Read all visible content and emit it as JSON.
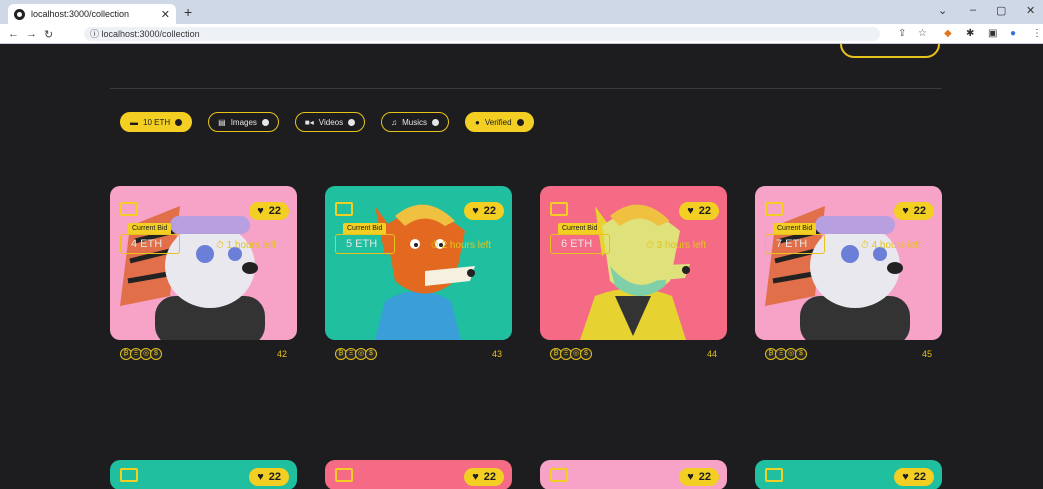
{
  "browser": {
    "tab_title": "localhost:3000/collection",
    "url": "localhost:3000/collection"
  },
  "filters": [
    {
      "label": "10 ETH",
      "active": true,
      "icon": "wallet-icon"
    },
    {
      "label": "Images",
      "active": false,
      "icon": "image-icon"
    },
    {
      "label": "Videos",
      "active": false,
      "icon": "video-icon"
    },
    {
      "label": "Musics",
      "active": false,
      "icon": "music-icon"
    },
    {
      "label": "Verified",
      "active": true,
      "icon": "user-icon"
    }
  ],
  "cards": [
    {
      "likes": "22",
      "id": "42",
      "bid_label": "Current Bid",
      "bid": "4 ETH",
      "time_left": "1 hours left",
      "bg": "#f7a3c8"
    },
    {
      "likes": "22",
      "id": "43",
      "bid_label": "Current Bid",
      "bid": "5 ETH",
      "time_left": "2 hours left",
      "bg": "#1fbfa0"
    },
    {
      "likes": "22",
      "id": "44",
      "bid_label": "Current Bid",
      "bid": "6 ETH",
      "time_left": "3 hours left",
      "bg": "#f56b85"
    },
    {
      "likes": "22",
      "id": "45",
      "bid_label": "Current Bid",
      "bid": "7 ETH",
      "time_left": "4 hours left",
      "bg": "#f7a3c8"
    }
  ],
  "cards_row2": [
    {
      "likes": "22",
      "bg": "#1fbfa0"
    },
    {
      "likes": "22",
      "bg": "#f56b85"
    },
    {
      "likes": "22",
      "bg": "#f7a3c8"
    },
    {
      "likes": "22",
      "bg": "#1fbfa0"
    }
  ],
  "colors": {
    "accent": "#f2cf22",
    "background": "#1d1d1f"
  }
}
